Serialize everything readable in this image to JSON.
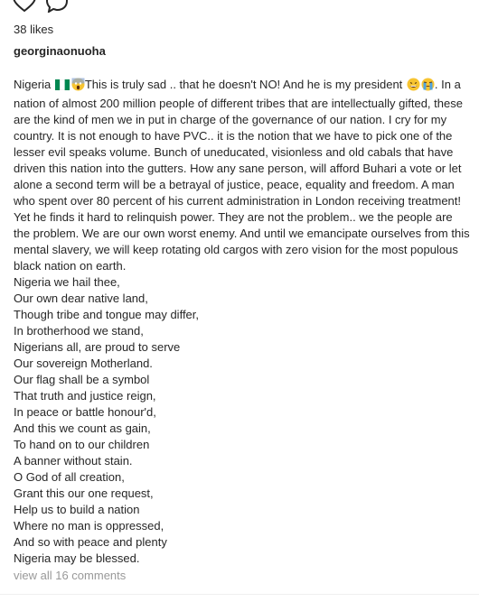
{
  "post": {
    "likes": "38 likes",
    "username": "georginaonuoha",
    "caption": {
      "lead": "Nigeria",
      "part1": "This is truly sad .. that he doesn't NO! And he is my president",
      "part2": ". In a nation of almost 200 million people of different tribes that are intellectually gifted, these are the kind of men we in put in charge of the governance of our nation. I cry for my country. It is not enough to have PVC.. it is the notion that we have to pick one of the lesser evil speaks volume. Bunch of uneducated, visionless and old cabals that have driven this nation into the gutters. How any sane person, will afford Buhari a vote or let alone a second term will be a betrayal of justice, peace, equality and freedom. A man who spent over 80 percent of his current administration in London receiving treatment! Yet he finds it hard to relinquish power. They are not the problem.. we the people are the problem. We are our own worst enemy. And until we emancipate ourselves from this mental slavery, we will keep rotating old cargos with zero vision for the most populous black nation on earth."
    },
    "poem": [
      "Nigeria we hail thee,",
      "Our own dear native land,",
      "Though tribe and tongue may differ,",
      "In brotherhood we stand,",
      "Nigerians all, are proud to serve",
      "Our sovereign Motherland.",
      "Our flag shall be a symbol",
      "That truth and justice reign,",
      "In peace or battle honour'd,",
      "And this we count as gain,",
      "To hand on to our children",
      "A banner without stain.",
      "O God of all creation,",
      "Grant this our one request,",
      "Help us to build a nation",
      "Where no man is oppressed,",
      "And so with peace and plenty",
      "Nigeria may be blessed."
    ],
    "comments_link": "view all 16 comments"
  },
  "icons": {
    "heart": "heart-icon",
    "comment": "comment-icon",
    "flag": "nigeria-flag-icon",
    "emoji_1": "screaming-face-emoji",
    "emoji_2": "grinning-sweat-emoji",
    "emoji_3": "loudly-crying-face-emoji"
  },
  "colors": {
    "text": "#262626",
    "muted": "#999999",
    "flag_green": "#008751",
    "flag_white": "#ffffff"
  }
}
